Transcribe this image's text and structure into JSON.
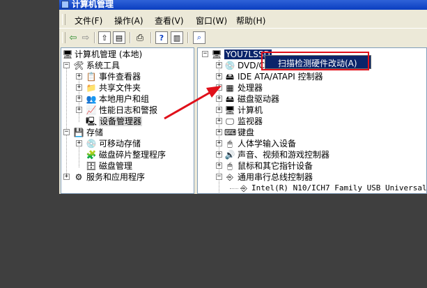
{
  "window": {
    "title": "计算机管理"
  },
  "menubar": {
    "items": [
      "文件(F)",
      "操作(A)",
      "查看(V)",
      "窗口(W)",
      "帮助(H)"
    ]
  },
  "toolbar": {
    "buttons": [
      "back-icon",
      "forward-icon",
      "up-folder-icon",
      "show-hide-tree-icon",
      "print-icon",
      "help-icon",
      "properties-icon",
      "scan-icon"
    ]
  },
  "left_tree": {
    "root": "计算机管理 (本地)",
    "system_tools": "系统工具",
    "event_viewer": "事件查看器",
    "shared_folders": "共享文件夹",
    "local_users": "本地用户和组",
    "perf_logs": "性能日志和警报",
    "device_manager": "设备管理器",
    "storage": "存储",
    "removable_storage": "可移动存储",
    "defrag": "磁盘碎片整理程序",
    "disk_mgmt": "磁盘管理",
    "services_apps": "服务和应用程序"
  },
  "right_tree": {
    "root": "YOU7LSSD",
    "items": [
      "DVD/CD",
      "IDE ATA/ATAPI 控制器",
      "处理器",
      "磁盘驱动器",
      "计算机",
      "监视器",
      "键盘",
      "人体学输入设备",
      "声音、视频和游戏控制器",
      "鼠标和其它指针设备",
      "通用串行总线控制器"
    ],
    "child": "Intel(R) N10/ICH7 Family USB Universal"
  },
  "context_menu": {
    "item": "扫描检测硬件改动(A)"
  },
  "colors": {
    "highlight_box": "#e0101a",
    "arrow": "#e0101a",
    "menu_selection": "#0a246a"
  }
}
